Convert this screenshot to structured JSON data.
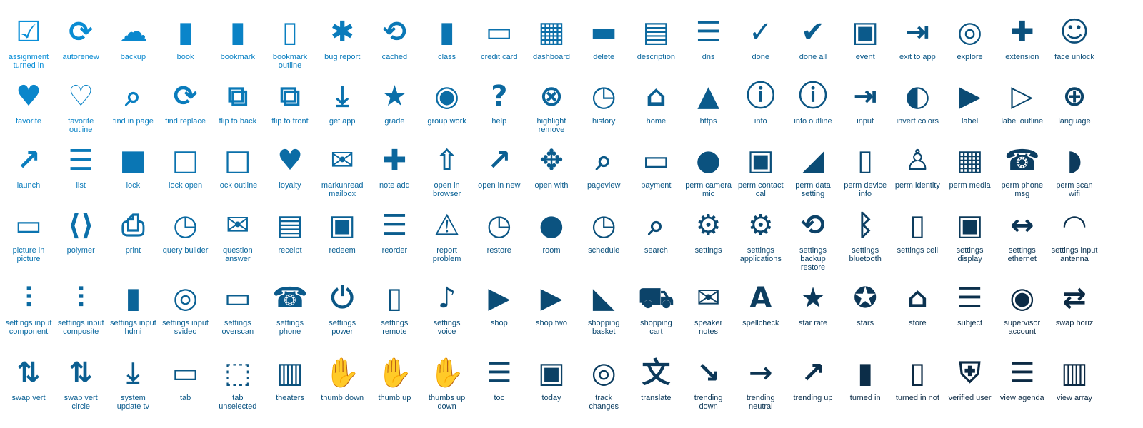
{
  "colors": {
    "start": "#0a8fd8",
    "end": "#0c2a44"
  },
  "rows": [
    [
      "assignment turned in",
      "autorenew",
      "backup",
      "book",
      "bookmark",
      "bookmark outline",
      "bug report",
      "cached",
      "class",
      "credit card",
      "dashboard",
      "delete",
      "description",
      "dns",
      "done",
      "done all",
      "event",
      "exit to app",
      "explore",
      "extension",
      "face unlock"
    ],
    [
      "favorite",
      "favorite outline",
      "find in page",
      "find replace",
      "flip to back",
      "flip to front",
      "get app",
      "grade",
      "group work",
      "help",
      "highlight remove",
      "history",
      "home",
      "https",
      "info",
      "info outline",
      "input",
      "invert colors",
      "label",
      "label outline",
      "language"
    ],
    [
      "launch",
      "list",
      "lock",
      "lock open",
      "lock outline",
      "loyalty",
      "markunread mailbox",
      "note add",
      "open in browser",
      "open in new",
      "open with",
      "pageview",
      "payment",
      "perm camera mic",
      "perm contact cal",
      "perm data setting",
      "perm device info",
      "perm identity",
      "perm media",
      "perm phone msg",
      "perm scan wifi"
    ],
    [
      "picture in picture",
      "polymer",
      "print",
      "query builder",
      "question answer",
      "receipt",
      "redeem",
      "reorder",
      "report problem",
      "restore",
      "room",
      "schedule",
      "search",
      "settings",
      "settings applications",
      "settings backup restore",
      "settings bluetooth",
      "settings cell",
      "settings display",
      "settings ethernet",
      "settings input antenna"
    ],
    [
      "settings input component",
      "settings input composite",
      "settings input hdmi",
      "settings input svideo",
      "settings overscan",
      "settings phone",
      "settings power",
      "settings remote",
      "settings voice",
      "shop",
      "shop two",
      "shopping basket",
      "shopping cart",
      "speaker notes",
      "spellcheck",
      "star rate",
      "stars",
      "store",
      "subject",
      "supervisor account",
      "swap horiz"
    ],
    [
      "swap vert",
      "swap vert circle",
      "system update tv",
      "tab",
      "tab unselected",
      "theaters",
      "thumb down",
      "thumb up",
      "thumbs up down",
      "toc",
      "today",
      "track changes",
      "translate",
      "trending down",
      "trending neutral",
      "trending up",
      "turned in",
      "turned in not",
      "verified user",
      "view agenda",
      "view array"
    ]
  ]
}
